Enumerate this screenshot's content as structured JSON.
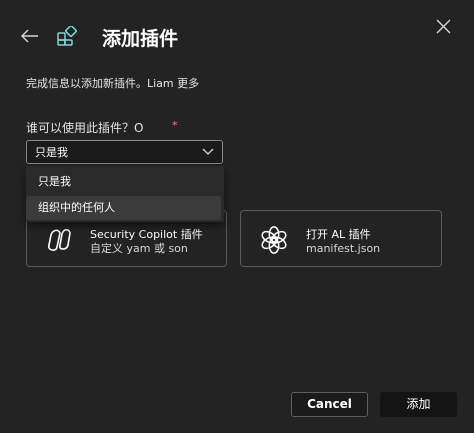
{
  "header": {
    "title": "添加插件",
    "back_icon": "arrow-left-icon",
    "plugin_icon": "plugin-puzzle-icon",
    "close_icon": "close-icon"
  },
  "info": "完成信息以添加新插件。Liam 更多",
  "who": {
    "label": "谁可以使用此插件？O",
    "required_mark": "*",
    "selected": "只是我",
    "options": [
      "只是我",
      "组织中的任何人"
    ]
  },
  "cards": [
    {
      "title": "Security Copilot 插件",
      "subtitle": "自定义 yam 或 son",
      "icon": "security-copilot-icon"
    },
    {
      "title": "打开 AL 插件",
      "subtitle": "manifest.json",
      "icon": "openai-icon"
    }
  ],
  "footer": {
    "cancel_label": "Cancel",
    "add_label": "添加"
  },
  "colors": {
    "background": "#232323",
    "accent_icon": "#7fd8d8",
    "required": "#e5848b"
  }
}
